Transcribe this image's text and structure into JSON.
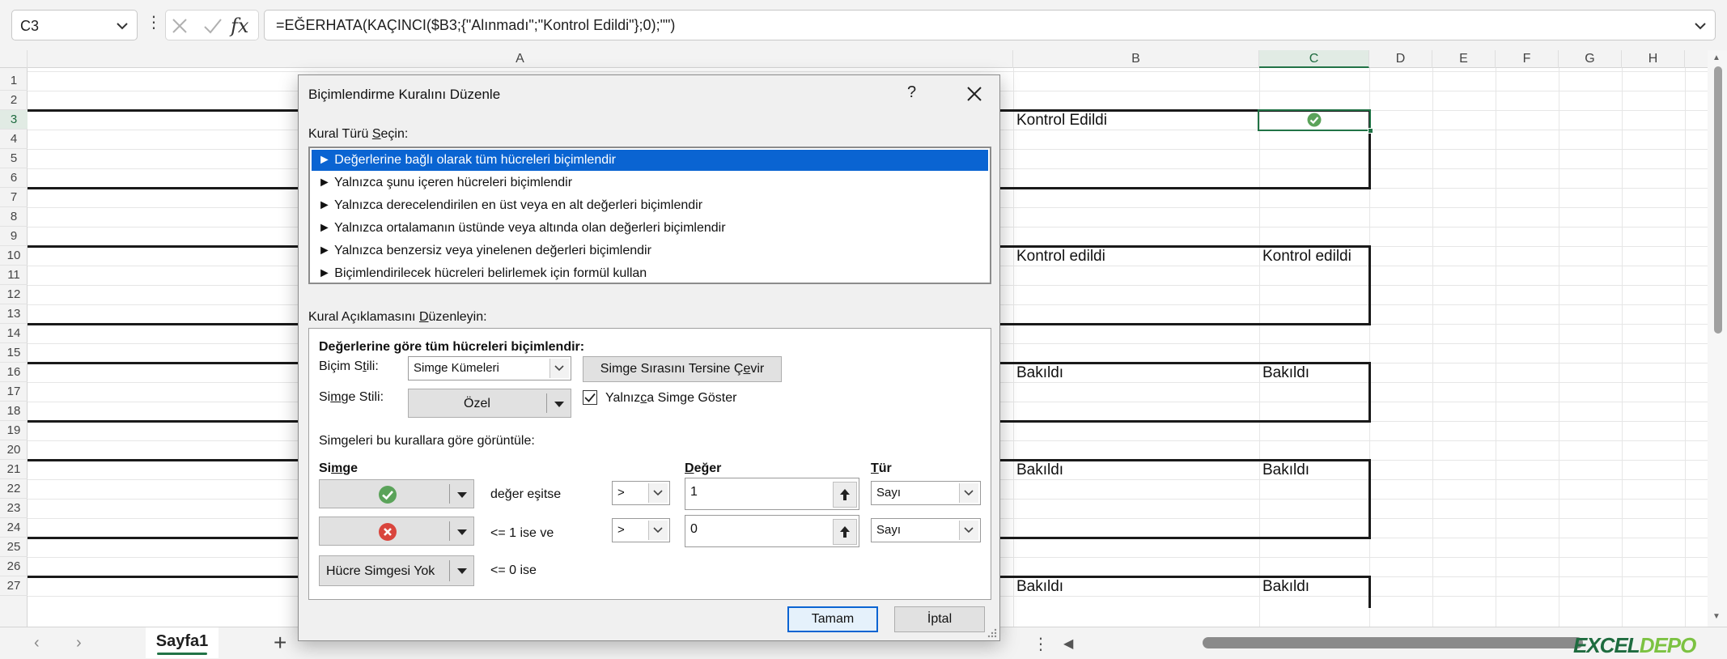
{
  "formula_bar": {
    "name_box": "C3",
    "formula": "=EĞERHATA(KAÇINCI($B3;{\"Alınmadı\";\"Kontrol Edildi\"};0);\"\")",
    "fx_label": "fx"
  },
  "grid": {
    "columns": [
      "A",
      "B",
      "C",
      "D",
      "E",
      "F",
      "G",
      "H"
    ],
    "rows": [
      "1",
      "2",
      "3",
      "4",
      "5",
      "6",
      "7",
      "8",
      "9",
      "10",
      "11",
      "12",
      "13",
      "14",
      "15",
      "16",
      "17",
      "18",
      "19",
      "20",
      "21",
      "22",
      "23",
      "24",
      "25",
      "26",
      "27"
    ],
    "selected_cell": "C3",
    "cells": {
      "b3": "Kontrol Edildi",
      "b10": "Kontrol edildi",
      "c10": "Kontrol edildi",
      "b16": "Bakıldı",
      "c16": "Bakıldı",
      "b21": "Bakıldı",
      "c21": "Bakıldı",
      "b27": "Bakıldı",
      "c27": "Bakıldı"
    },
    "c3_icon": "green-check-icon"
  },
  "sheet_tabs": {
    "active": "Sayfa1"
  },
  "watermark": {
    "a": "EXCEL",
    "b": "DEPO"
  },
  "dialog": {
    "title": "Biçimlendirme Kuralını Düzenle",
    "help": "?",
    "rule_type_label": {
      "a": "Kural Türü ",
      "u": "S",
      "b": "eçin:"
    },
    "rule_types": [
      "► Değerlerine bağlı olarak tüm hücreleri biçimlendir",
      "► Yalnızca şunu içeren hücreleri biçimlendir",
      "► Yalnızca derecelendirilen en üst veya en alt değerleri biçimlendir",
      "► Yalnızca ortalamanın üstünde veya altında olan değerleri biçimlendir",
      "► Yalnızca benzersiz veya yinelenen değerleri biçimlendir",
      "► Biçimlendirilecek hücreleri belirlemek için formül kullan"
    ],
    "selected_rule_index": 0,
    "desc_label": {
      "a": "Kural Açıklamasını ",
      "u": "D",
      "b": "üzenleyin:"
    },
    "desc_heading": "Değerlerine göre tüm hücreleri biçimlendir:",
    "format_style_label": {
      "a": "Biçim S",
      "u": "t",
      "b": "ili:"
    },
    "format_style_value": "Simge Kümeleri",
    "reverse_button": {
      "a": "Simge Sırasını Tersine Ç",
      "u": "e",
      "b": "vir"
    },
    "icon_style_label": {
      "a": "Si",
      "u": "m",
      "b": "ge Stili:"
    },
    "icon_style_value": "Özel",
    "show_icon_only": {
      "a": "Yalnız",
      "u": "c",
      "b": "a Simge Göster"
    },
    "show_icon_only_checked": true,
    "rules_heading": "Simgeleri bu kurallara göre görüntüle:",
    "col_icon": {
      "a": "Si",
      "u": "m",
      "b": "ge"
    },
    "col_value": {
      "a": "",
      "u": "D",
      "b": "eğer"
    },
    "col_type": {
      "a": "",
      "u": "T",
      "b": "ür"
    },
    "rows": [
      {
        "icon": "green-check-icon",
        "condition": "değer eşitse",
        "operator": ">",
        "value": "1",
        "type": "Sayı"
      },
      {
        "icon": "red-x-icon",
        "condition": "<= 1 ise ve",
        "operator": ">",
        "value": "0",
        "type": "Sayı"
      },
      {
        "icon_label": "Hücre Simgesi Yok",
        "condition": "<= 0 ise"
      }
    ],
    "ok": "Tamam",
    "cancel": "İptal"
  },
  "colors": {
    "accent_green": "#217346",
    "selection_blue": "#0a64d2",
    "check_green": "#5ba35a",
    "x_red": "#d9453d"
  }
}
